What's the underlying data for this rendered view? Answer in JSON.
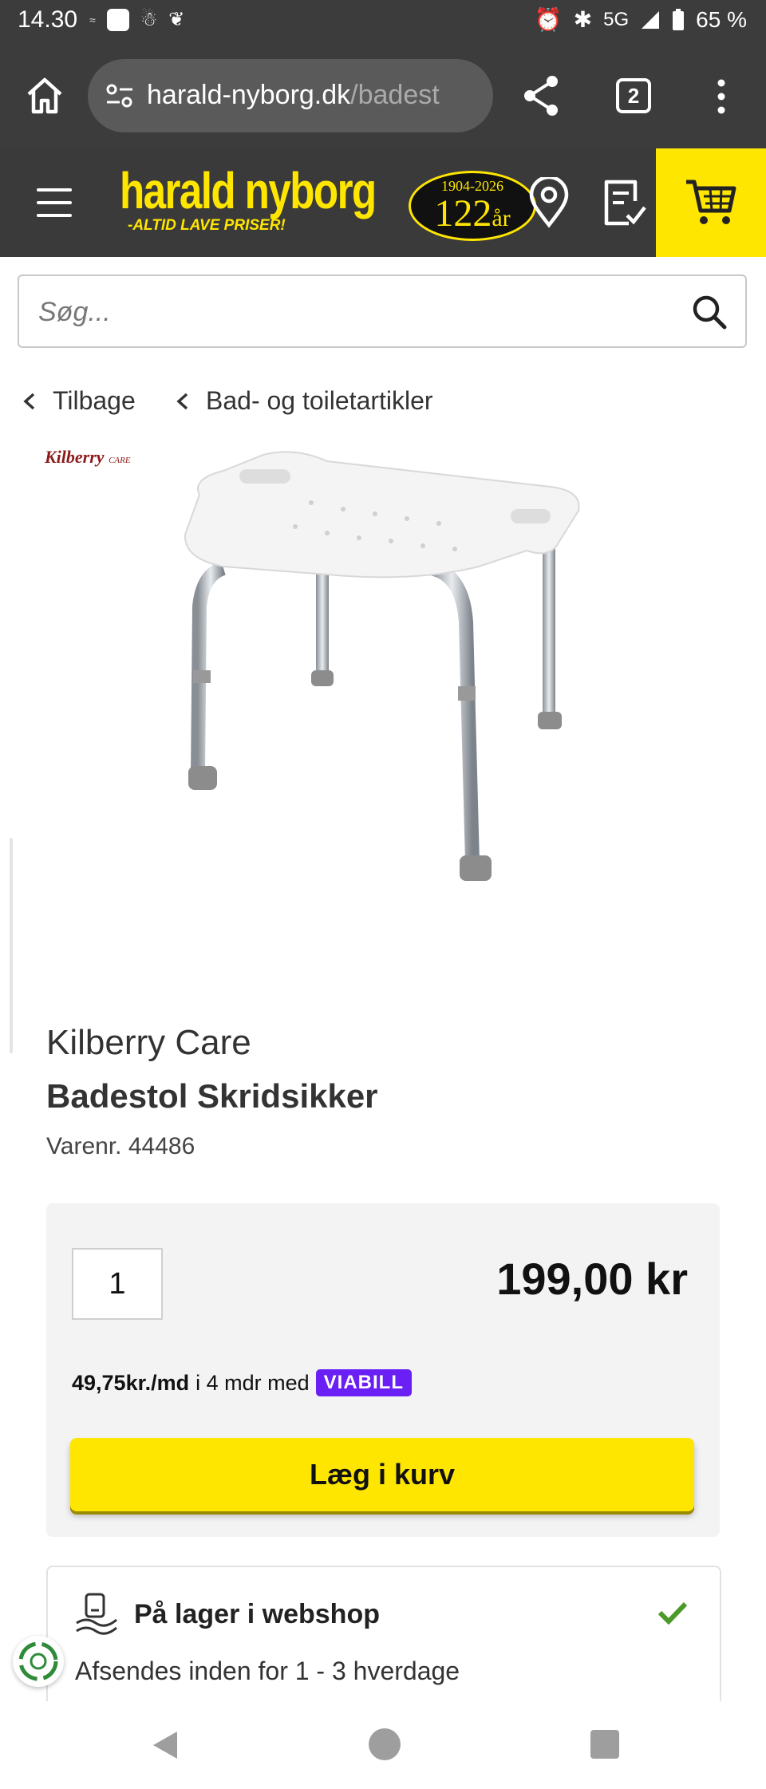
{
  "status_bar": {
    "time": "14.30",
    "network": "5G",
    "battery": "65 %"
  },
  "browser": {
    "url_host": "harald-nyborg.dk",
    "url_path": "/badest",
    "tab_count": "2"
  },
  "header": {
    "logo_name": "harald nyborg",
    "logo_tagline": "-ALTID LAVE PRISER!",
    "anniversary_years": "1904-2026",
    "anniversary_count": "122",
    "anniversary_suffix": "år",
    "accent_color": "#ffe600"
  },
  "search": {
    "placeholder": "Søg..."
  },
  "breadcrumb": {
    "back_label": "Tilbage",
    "category_label": "Bad- og toiletartikler"
  },
  "product": {
    "brand_logo_text": "Kilberry",
    "brand_logo_sub": "CARE",
    "brand": "Kilberry Care",
    "title": "Badestol Skridsikker",
    "sku": "Varenr. 44486"
  },
  "buy": {
    "quantity": "1",
    "price": "199,00 kr",
    "finance_amount": "49,75kr./md",
    "finance_text": "i 4 mdr med",
    "finance_provider": "VIABILL",
    "add_to_cart": "Læg i kurv"
  },
  "stock": {
    "title": "På lager i webshop",
    "subtitle": "Afsendes inden for 1 - 3 hverdage"
  }
}
